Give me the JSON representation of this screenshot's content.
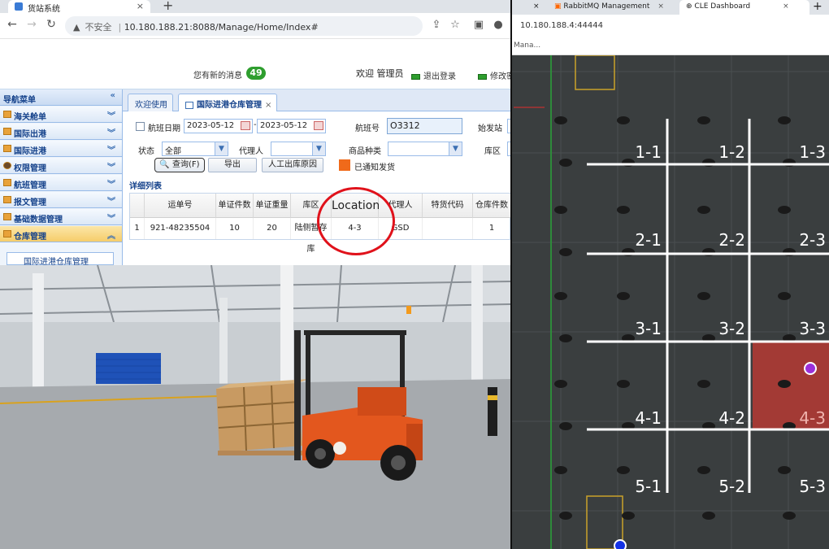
{
  "left_browser": {
    "tab_title": "货站系统",
    "address": {
      "insecure_label": "不安全",
      "url": "10.180.188.21:8088/Manage/Home/Index#"
    }
  },
  "app_header": {
    "new_messages_label": "您有新的消息",
    "message_count": "49",
    "welcome": "欢迎 管理员",
    "logout": "退出登录",
    "modify": "修改密"
  },
  "sidebar": {
    "title": "导航菜单",
    "items": [
      {
        "label": "海关舱单"
      },
      {
        "label": "国际出港"
      },
      {
        "label": "国际进港"
      },
      {
        "label": "权限管理"
      },
      {
        "label": "航班管理"
      },
      {
        "label": "报文管理"
      },
      {
        "label": "基础数据管理"
      },
      {
        "label": "仓库管理"
      }
    ],
    "sub_item": "国际进港仓库管理"
  },
  "main": {
    "tabs": [
      {
        "label": "欢迎使用"
      },
      {
        "label": "国际进港仓库管理"
      }
    ],
    "form": {
      "flight_date_label": "航班日期",
      "date_from": "2023-05-12",
      "date_sep": "-",
      "date_to": "2023-05-12",
      "flight_no_label": "航班号",
      "flight_no": "O3312",
      "origin_label": "始发站",
      "status_label": "状态",
      "status_value": "全部",
      "agent_label": "代理人",
      "goods_type_label": "商品种类",
      "area_label": "库区",
      "query_button": "查询(F)",
      "export_button": "导出",
      "manual_button": "人工出库原因",
      "notified_label": "已通知发货"
    },
    "detail_title": "详细列表",
    "table": {
      "headers": [
        "",
        "运单号",
        "单证件数",
        "单证重量",
        "库区",
        "Location",
        "代理人",
        "特货代码",
        "仓库件数"
      ],
      "rows": [
        [
          "1",
          "921-48235504",
          "10",
          "20",
          "陆侧暂存库",
          "4-3",
          "GSD",
          "",
          "1"
        ]
      ]
    }
  },
  "right_browser": {
    "tabs": [
      {
        "label": "RabbitMQ Management"
      },
      {
        "label": "CLE Dashboard"
      }
    ],
    "address": "10.180.188.4:44444",
    "bookmark": "Mana..."
  },
  "map": {
    "zones": [
      "1-1",
      "1-2",
      "1-3",
      "2-1",
      "2-2",
      "2-3",
      "3-1",
      "3-2",
      "3-3",
      "4-1",
      "4-2",
      "4-3",
      "5-1",
      "5-2",
      "5-3"
    ],
    "highlighted_zone": "4-3",
    "highlight_color": "#a33a35",
    "tag_color": "#9b30d8",
    "anchor_color": "#1432e6"
  },
  "colors": {
    "accent_blue": "#15428b",
    "message_badge": "#2e9e2e",
    "annotation_red": "#e0121b",
    "notify_orange": "#f06a1a"
  }
}
